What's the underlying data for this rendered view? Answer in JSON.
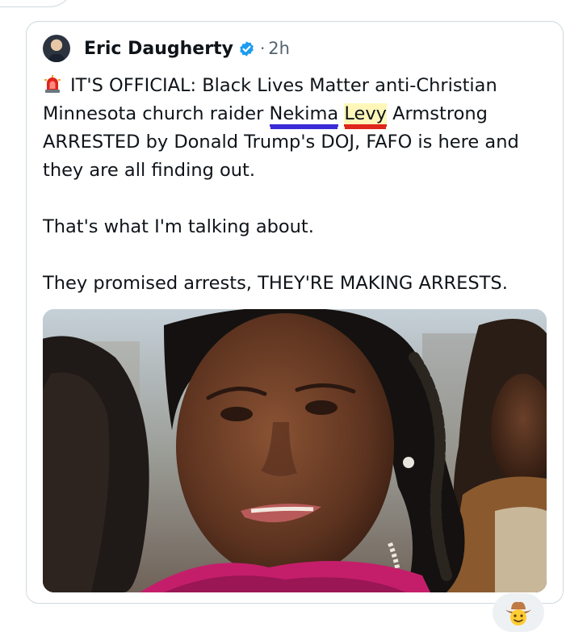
{
  "post": {
    "author": "Eric Daugherty",
    "separator": "·",
    "time": "2h",
    "icons": {
      "verified": "verified-badge-icon",
      "siren": "police-siren-emoji",
      "reaction": "cowboy-emoji"
    },
    "text": {
      "p1_before": "IT'S OFFICIAL: Black Lives Matter anti-Christian Minnesota church raider ",
      "p1_name1": "Nekima",
      "p1_space": " ",
      "p1_name2": "Levy",
      "p1_after": " Armstrong ARRESTED by Donald Trump's DOJ, FAFO is here and they are all finding out.",
      "p2": "That's what I'm talking about.",
      "p3": "They promised arrests, THEY'RE MAKING ARRESTS."
    },
    "colors": {
      "verified": "#1d9bf0",
      "underline_blue": "#3b2bd6",
      "underline_red": "#e0251b",
      "highlight_yellow": "#fff082"
    }
  }
}
